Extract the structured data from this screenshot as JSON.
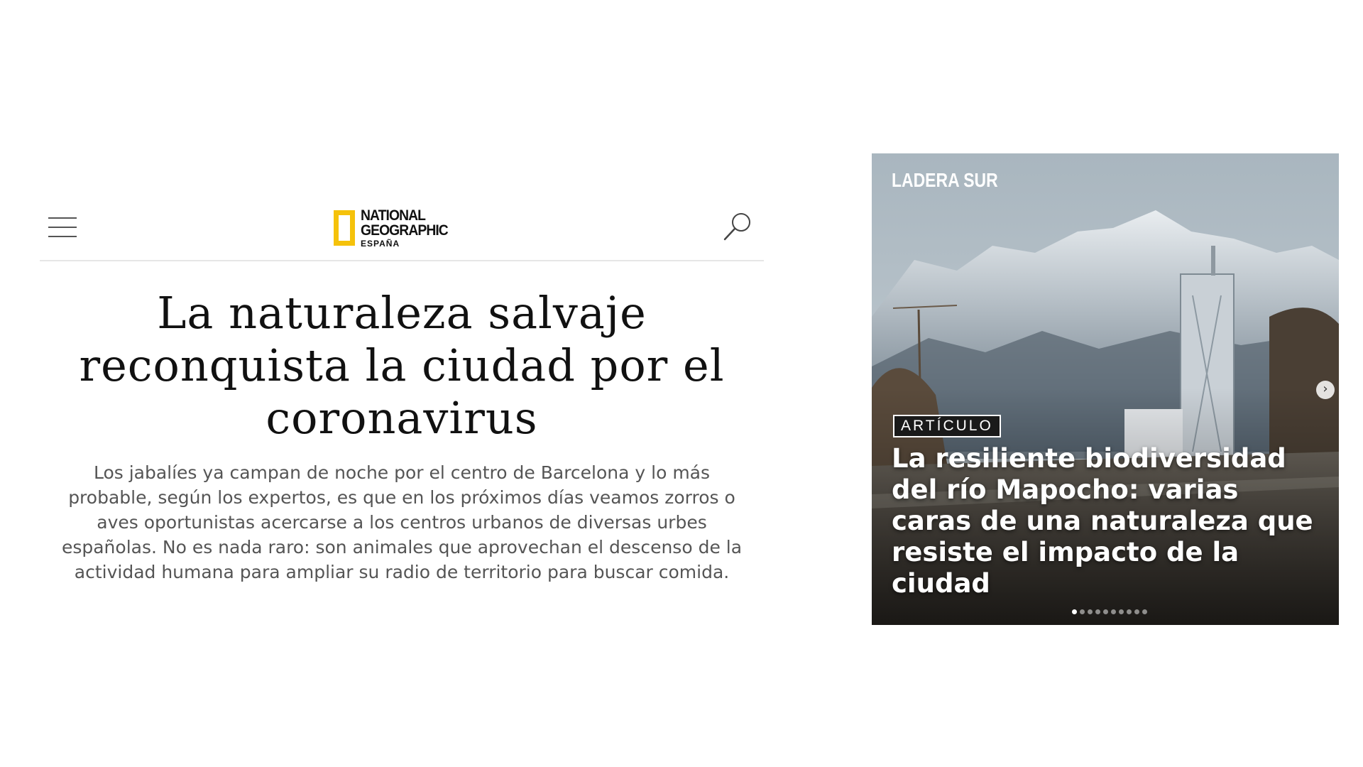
{
  "left_article": {
    "logo": {
      "line1": "NATIONAL",
      "line2": "GEOGRAPHIC",
      "line3": "ESPAÑA",
      "accent_color": "#f5c20b"
    },
    "menu_icon": "hamburger-menu-icon",
    "search_icon": "search-icon",
    "title": "La naturaleza salvaje reconquista la ciudad por el coronavirus",
    "lead": "Los jabalíes ya campan de noche por el centro de Barcelona y lo más probable, según los expertos, es que en los próximos días veamos zorros o aves oportunistas acercarse a los centros urbanos de diversas urbes españolas. No es nada raro: son animales que aprovechan el descenso de la actividad humana para ampliar su radio de territorio para buscar comida."
  },
  "right_card": {
    "brand": "LADERA SUR",
    "tag": "ARTÍCULO",
    "headline": "La resiliente biodiversidad del río Mapocho: varias caras de una naturaleza que resiste el impacto de la ciudad",
    "next_icon": "chevron-right-icon",
    "dots_total": 10,
    "dots_active_index": 0
  }
}
